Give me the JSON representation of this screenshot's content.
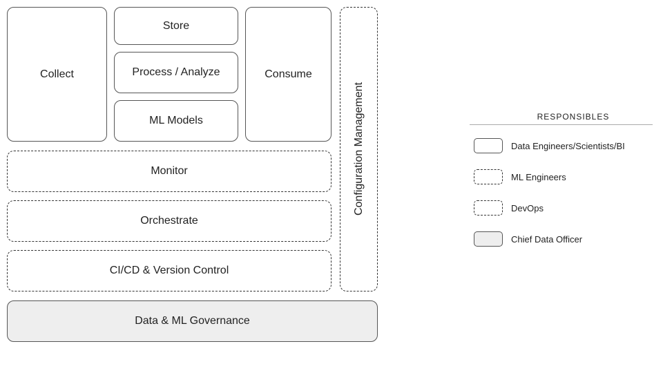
{
  "diagram": {
    "left_stack": {
      "collect": "Collect",
      "store": "Store",
      "process_analyze": "Process / Analyze",
      "ml_models": "ML Models",
      "consume": "Consume"
    },
    "monitor": "Monitor",
    "orchestrate": "Orchestrate",
    "cicd": "CI/CD & Version Control",
    "config_mgmt": "Configuration Management",
    "governance": "Data & ML Governance"
  },
  "legend": {
    "title": "RESPONSIBLES",
    "items": [
      {
        "label": "Data Engineers/Scientists/BI",
        "style": "solid"
      },
      {
        "label": "ML Engineers",
        "style": "dashed-long"
      },
      {
        "label": "DevOps",
        "style": "dashed-short"
      },
      {
        "label": "Chief Data Officer",
        "style": "filled"
      }
    ]
  }
}
